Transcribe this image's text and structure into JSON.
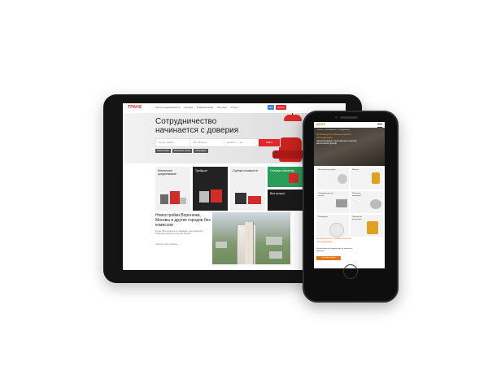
{
  "tablet": {
    "logo": "ТРАНЕ",
    "menu": [
      "Купить недвижимость",
      "Аренда",
      "Коммерческая",
      "Ипотека",
      "Услуги"
    ],
    "actions": [
      {
        "label": "RU",
        "color": "#3b7de0"
      },
      {
        "label": "Войти",
        "color": "#e0262b"
      }
    ],
    "hero": {
      "title": "Сотрудничество начинается с доверия",
      "search_fields": [
        "Город, район",
        "Тип объекта",
        "Цена от — до"
      ],
      "search_button": "Найти",
      "chips": [
        "Новостройки",
        "Вторичное жильё",
        "Загородная"
      ]
    },
    "cards": [
      {
        "label": "Ипотечное кредитование",
        "style": "light"
      },
      {
        "label": "Трейд-ин",
        "style": "dark"
      },
      {
        "label": "Оценка стоимости",
        "style": "light"
      },
      {
        "label": "Отзывы клиентов",
        "style": "green"
      },
      {
        "label": "Все услуги",
        "style": "black"
      }
    ],
    "section": {
      "title": "Новостройки Воронежа, Москвы и других городов без комиссии",
      "paragraph": "Более 500 объектов от надёжных застройщиков. Подберём квартиру под ваш бюджет.",
      "note": "Смотреть все объекты"
    },
    "colors": {
      "accent": "#e0262b",
      "green": "#2a9d5a"
    }
  },
  "phone": {
    "logo": "ЦЕНТР",
    "breadcrumb": "Главная / Производство / Оборудование",
    "hero_title": "Производство промышленного оборудования",
    "hero_subtitle": "Проектирование, изготовление и монтаж металлоконструкций",
    "tiles": [
      "Металлоконструкции",
      "Монтаж",
      "Оборудование для склада",
      "Шнековые конвейеры",
      "Резервуары",
      "Подъёмные механизмы"
    ],
    "section_title": "Производство промышленного оборудования",
    "section_text": "Изготавливаем оборудование по чертежам заказчика",
    "cta": "Оставить заявку",
    "colors": {
      "accent": "#e07a1f"
    }
  }
}
